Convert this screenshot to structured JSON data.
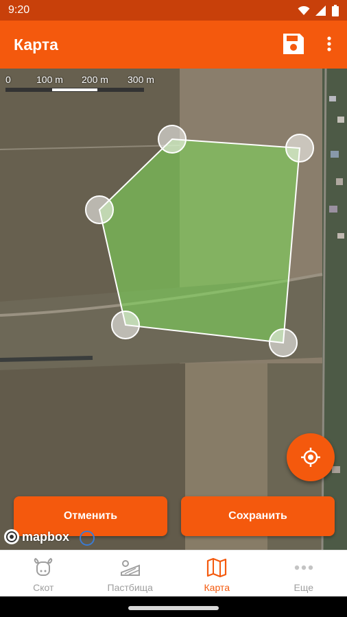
{
  "status": {
    "time": "9:20"
  },
  "app_bar": {
    "title": "Карта",
    "save_icon": "save-icon",
    "more_icon": "more-vert-icon"
  },
  "map": {
    "scale_labels": [
      "0",
      "100 m",
      "200 m",
      "300 m"
    ],
    "attribution": "mapbox"
  },
  "actions": {
    "cancel_label": "Отменить",
    "save_label": "Сохранить"
  },
  "bottom_nav": {
    "items": [
      {
        "label": "Скот",
        "icon": "cow-icon"
      },
      {
        "label": "Пастбища",
        "icon": "pasture-icon"
      },
      {
        "label": "Карта",
        "icon": "map-icon"
      },
      {
        "label": "Еще",
        "icon": "more-horiz-icon"
      }
    ],
    "active_index": 2
  },
  "colors": {
    "accent": "#f4590d",
    "status_bar": "#c8400a",
    "polygon_fill": "#7fd65a",
    "inactive_nav": "#9e9e9e"
  }
}
